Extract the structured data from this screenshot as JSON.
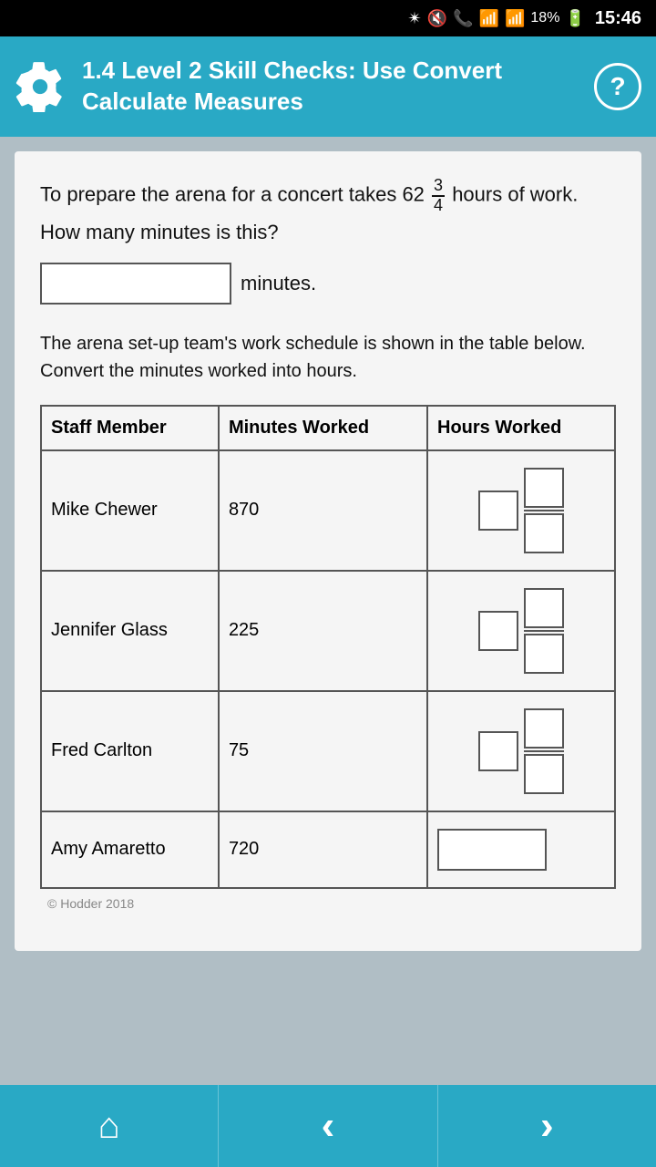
{
  "statusBar": {
    "battery": "18%",
    "time": "15:46",
    "icons": "🔵🔇📞📶📶"
  },
  "header": {
    "title": "1.4 Level 2 Skill Checks: Use Convert Calculate Measures",
    "help_label": "?",
    "gear_icon": "gear"
  },
  "content": {
    "question_part1": "To prepare the arena for a concert takes 62",
    "fraction_numerator": "3",
    "fraction_denominator": "4",
    "question_part2": "hours of work.",
    "question_sub": "How many minutes is this?",
    "minutes_label": "minutes.",
    "input_placeholder": "",
    "paragraph": "The arena set-up team's work schedule is shown in the table below. Convert the minutes worked into hours.",
    "table": {
      "headers": [
        "Staff Member",
        "Minutes Worked",
        "Hours Worked"
      ],
      "rows": [
        {
          "staff": "Mike Chewer",
          "minutes": "870",
          "type": "fraction"
        },
        {
          "staff": "Jennifer Glass",
          "minutes": "225",
          "type": "fraction"
        },
        {
          "staff": "Fred Carlton",
          "minutes": "75",
          "type": "fraction"
        },
        {
          "staff": "Amy Amaretto",
          "minutes": "720",
          "type": "whole"
        }
      ]
    }
  },
  "nav": {
    "home_icon": "⌂",
    "back_icon": "‹",
    "forward_icon": "›"
  },
  "copyright": "© Hodder 2018"
}
